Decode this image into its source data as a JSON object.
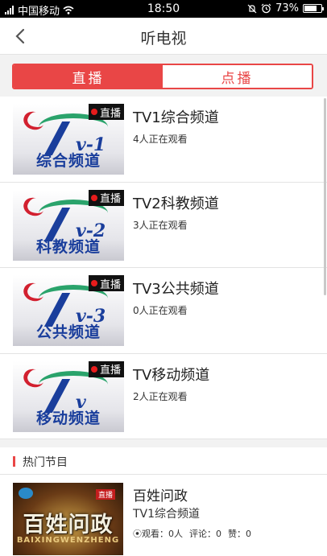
{
  "status_bar": {
    "carrier": "中国移动",
    "time": "18:50",
    "battery": "73%",
    "battery_level": 0.73
  },
  "header": {
    "title": "听电视",
    "back_icon": "chevron-left-icon"
  },
  "tabs": [
    {
      "label": "直播",
      "active": true
    },
    {
      "label": "点播",
      "active": false
    }
  ],
  "channels": [
    {
      "name": "TV1综合频道",
      "viewers": "4人正在观看",
      "logo_num": "-1",
      "logo_text": "综合频道",
      "badge": "直播"
    },
    {
      "name": "TV2科教频道",
      "viewers": "3人正在观看",
      "logo_num": "-2",
      "logo_text": "科教频道",
      "badge": "直播"
    },
    {
      "name": "TV3公共频道",
      "viewers": "0人正在观看",
      "logo_num": "-3",
      "logo_text": "公共频道",
      "badge": "直播"
    },
    {
      "name": "TV移动频道",
      "viewers": "2人正在观看",
      "logo_num": "",
      "logo_text": "移动频道",
      "badge": "直播"
    }
  ],
  "hot": {
    "section_title": "热门节目",
    "item": {
      "name": "百姓问政",
      "channel": "TV1综合频道",
      "views": "⦿观看：0人",
      "comments": "评论：0",
      "likes": "赞：0",
      "thumb_title": "百姓问政",
      "thumb_subtitle": "BAIXINGWENZHENG",
      "thumb_tag": "直播"
    }
  },
  "colors": {
    "accent": "#e94646",
    "logo_blue": "#1a3e9c",
    "logo_green": "#2aa36b",
    "logo_red": "#d2202f"
  }
}
